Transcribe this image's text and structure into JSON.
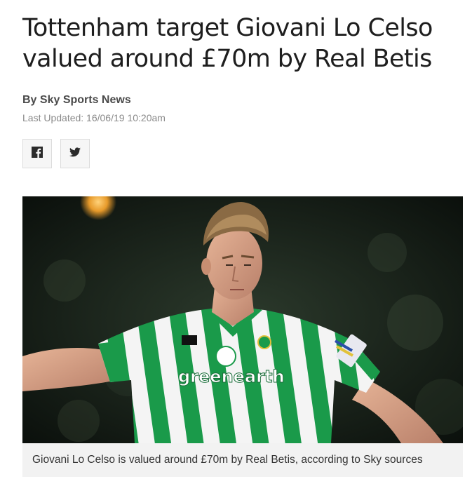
{
  "article": {
    "headline": "Tottenham target Giovani Lo Celso valued around £70m by Real Betis",
    "byline": "By Sky Sports News",
    "last_updated": "Last Updated: 16/06/19 10:20am"
  },
  "share": {
    "facebook_icon": "facebook-icon",
    "twitter_icon": "twitter-icon"
  },
  "image": {
    "sponsor_text": "greenearth",
    "caption": "Giovani Lo Celso is valued around £70m by Real Betis, according to Sky sources"
  },
  "colors": {
    "kit_green": "#1a9a4a",
    "kit_white": "#f4f4f4",
    "caption_bg": "#f2f2f2"
  }
}
